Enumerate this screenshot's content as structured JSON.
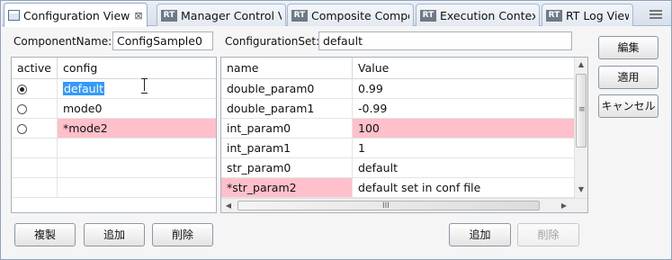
{
  "tabs": [
    {
      "label": "Configuration View",
      "icon": "view-icon",
      "active": true,
      "close": "⊠"
    },
    {
      "label": "Manager Control Vi",
      "icon": "rt-icon",
      "active": false
    },
    {
      "label": "Composite Compon",
      "icon": "rt-icon",
      "active": false
    },
    {
      "label": "Execution Context",
      "icon": "rt-icon",
      "active": false
    },
    {
      "label": "RT Log View",
      "icon": "rt-icon",
      "active": false
    }
  ],
  "rt_badge": "RT",
  "component": {
    "label": "ComponentName:",
    "value": "ConfigSample0"
  },
  "config_set": {
    "label": "ConfigurationSet:",
    "value": "default"
  },
  "left_table": {
    "headers": {
      "active": "active",
      "config": "config"
    },
    "rows": [
      {
        "config": "default",
        "selected": true,
        "modified": false
      },
      {
        "config": "mode0",
        "selected": false,
        "modified": false
      },
      {
        "config": "*mode2",
        "selected": false,
        "modified": true
      }
    ]
  },
  "right_table": {
    "headers": {
      "name": "name",
      "value": "Value"
    },
    "rows": [
      {
        "name": "double_param0",
        "value": "0.99",
        "name_mod": false,
        "value_mod": false
      },
      {
        "name": "double_param1",
        "value": "-0.99",
        "name_mod": false,
        "value_mod": false
      },
      {
        "name": "int_param0",
        "value": "100",
        "name_mod": false,
        "value_mod": true
      },
      {
        "name": "int_param1",
        "value": "1",
        "name_mod": false,
        "value_mod": false
      },
      {
        "name": "str_param0",
        "value": "default",
        "name_mod": false,
        "value_mod": false
      },
      {
        "name": "*str_param2",
        "value": "default set in conf file",
        "name_mod": true,
        "value_mod": false
      }
    ]
  },
  "side_buttons": {
    "edit": "編集",
    "apply": "適用",
    "cancel": "キャンセル"
  },
  "left_buttons": {
    "copy": "複製",
    "add": "追加",
    "delete": "削除"
  },
  "right_buttons": {
    "add": "追加",
    "delete": "削除"
  },
  "scroll": {
    "up": "▲",
    "down": "▼",
    "left": "◀",
    "right": "▶",
    "vgrip": "≡",
    "hgrip": "III"
  },
  "colors": {
    "modified": "#ffc0cb",
    "selection": "#3399ff"
  }
}
